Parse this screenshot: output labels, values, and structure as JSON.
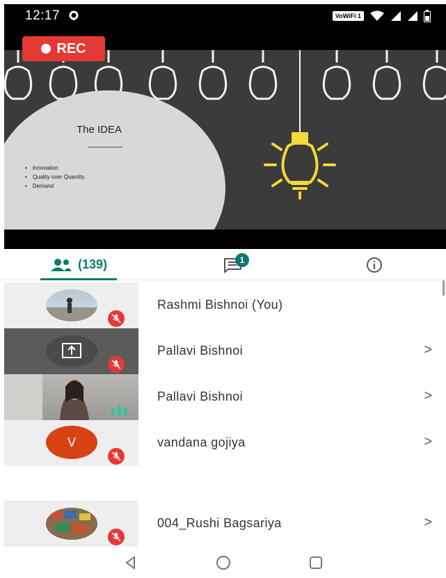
{
  "status_bar": {
    "time": "12:17",
    "network_badge": "VoWiFi 1"
  },
  "stage": {
    "rec_label": "REC",
    "slide": {
      "title": "The IDEA",
      "bullets": [
        "Innovation",
        "Quality over Quantity",
        "Demand"
      ]
    }
  },
  "tabs": {
    "people_count": "(139)",
    "chat_badge": "1"
  },
  "participants": [
    {
      "name": "Rashmi Bishnoi (You)",
      "muted": true,
      "tile": "photo"
    },
    {
      "name": "Pallavi Bishnoi",
      "muted": true,
      "tile": "screen-share"
    },
    {
      "name": "Pallavi Bishnoi",
      "muted": false,
      "tile": "video"
    },
    {
      "name": "vandana gojiya",
      "muted": true,
      "tile": "initial",
      "initial": "V"
    },
    {
      "name": "004_Rushi Bagsariya",
      "muted": true,
      "tile": "photo"
    }
  ],
  "colors": {
    "accent": "#0b7a6d",
    "rec": "#e53935",
    "mute": "#e53935",
    "avatar_v": "#d84315"
  }
}
